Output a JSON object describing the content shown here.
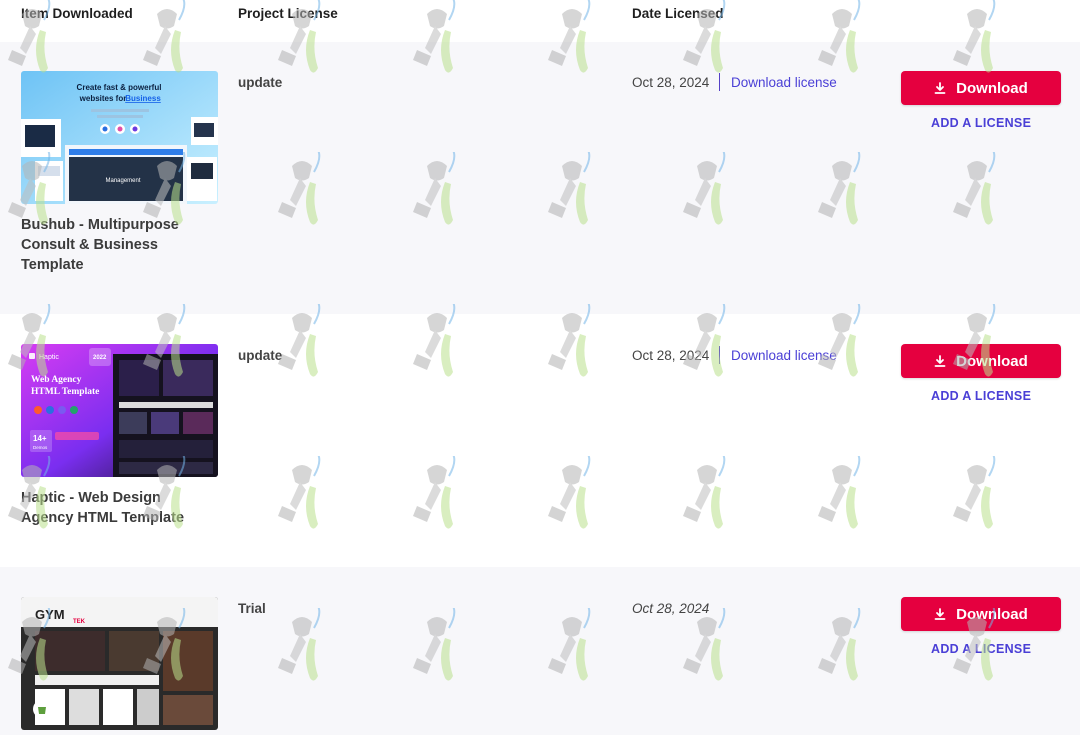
{
  "header": {
    "col_item": "Item Downloaded",
    "col_license": "Project License",
    "col_date": "Date Licensed"
  },
  "items": [
    {
      "title": "Bushub - Multipurpose Consult & Business Template",
      "license": "update",
      "date": "Oct 28, 2024",
      "download_license": "Download license",
      "download_label": "Download",
      "add_license": "ADD A LICENSE",
      "thumb_text": "Create fast & powerful websites for Business",
      "thumb_highlight": "Business",
      "thumb_caption": "Management"
    },
    {
      "title": "Haptic - Web Design Agency HTML Template",
      "license": "update",
      "date": "Oct 28, 2024",
      "download_license": "Download license",
      "download_label": "Download",
      "add_license": "ADD A LICENSE",
      "thumb_brand": "Haptic",
      "thumb_text": "Web Agency HTML Template",
      "thumb_badge": "14+",
      "thumb_badge_sub": "Demos",
      "thumb_year": "2022"
    },
    {
      "title": "",
      "license": "Trial",
      "date": "Oct 28, 2024",
      "download_license": "",
      "download_label": "Download",
      "add_license": "ADD A LICENSE",
      "thumb_brand": "GYM",
      "thumb_brand_sub": "TEK"
    }
  ],
  "colors": {
    "accent_red": "#e5003f",
    "link_purple": "#4a3fd6",
    "row_alt_bg": "#f7f7fa"
  },
  "icons": {
    "download": "download-arrow-icon",
    "shopify": "shopify-bag-icon"
  }
}
